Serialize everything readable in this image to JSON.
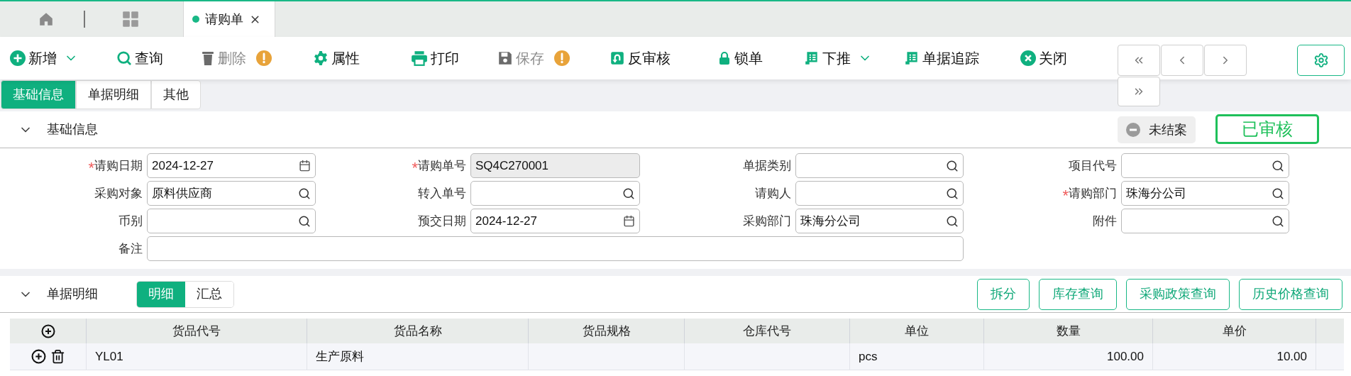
{
  "tabs": [
    {
      "label": "请购单",
      "selected": true
    }
  ],
  "toolbar": [
    {
      "label": "新增",
      "disabled": false,
      "warning": false,
      "dropdown": true
    },
    {
      "label": "查询",
      "disabled": false,
      "warning": false,
      "dropdown": false
    },
    {
      "label": "删除",
      "disabled": true,
      "warning": true,
      "dropdown": false
    },
    {
      "label": "属性",
      "disabled": false,
      "warning": false,
      "dropdown": false
    },
    {
      "label": "打印",
      "disabled": false,
      "warning": false,
      "dropdown": false
    },
    {
      "label": "保存",
      "disabled": true,
      "warning": true,
      "dropdown": false
    },
    {
      "label": "反审核",
      "disabled": false,
      "warning": false,
      "dropdown": false
    },
    {
      "label": "锁单",
      "disabled": false,
      "warning": false,
      "dropdown": false
    },
    {
      "label": "下推",
      "disabled": false,
      "warning": false,
      "dropdown": true
    },
    {
      "label": "单据追踪",
      "disabled": false,
      "warning": false,
      "dropdown": false
    },
    {
      "label": "关闭",
      "disabled": false,
      "warning": false,
      "dropdown": false
    }
  ],
  "page_tabs": [
    {
      "label": "基础信息",
      "selected": true
    },
    {
      "label": "单据明细",
      "selected": false
    },
    {
      "label": "其他",
      "selected": false
    }
  ],
  "basic_section": {
    "title": "基础信息",
    "expanded": true,
    "required_mark": "*",
    "status_badge": "未结案",
    "stamp": "已审核",
    "fields": [
      {
        "label": "请购日期",
        "required": true,
        "kind": "date",
        "value": "2024-12-27"
      },
      {
        "label": "请购单号",
        "required": true,
        "kind": "readonly",
        "value": "SQ4C270001"
      },
      {
        "label": "单据类别",
        "required": false,
        "kind": "lookup"
      },
      {
        "label": "项目代号",
        "required": false,
        "kind": "lookup"
      },
      {
        "label": "采购对象",
        "required": false,
        "kind": "lookup",
        "value": "原料供应商"
      },
      {
        "label": "转入单号",
        "required": false,
        "kind": "lookup"
      },
      {
        "label": "请购人",
        "required": false,
        "kind": "lookup"
      },
      {
        "label": "请购部门",
        "required": true,
        "kind": "lookup",
        "value": "珠海分公司"
      },
      {
        "label": "币别",
        "required": false,
        "kind": "lookup"
      },
      {
        "label": "预交日期",
        "required": false,
        "kind": "date",
        "value": "2024-12-27"
      },
      {
        "label": "采购部门",
        "required": false,
        "kind": "lookup",
        "value": "珠海分公司"
      },
      {
        "label": "附件",
        "required": false,
        "kind": "lookup"
      },
      {
        "label": "备注",
        "required": false,
        "kind": "wide"
      }
    ]
  },
  "detail_section": {
    "title": "单据明细",
    "expanded": true,
    "view_toggle": [
      {
        "label": "明细",
        "selected": true
      },
      {
        "label": "汇总",
        "selected": false
      }
    ],
    "buttons": [
      "拆分",
      "库存查询",
      "采购政策查询",
      "历史价格查询"
    ],
    "table": {
      "columns": [
        {
          "label": "货品代号",
          "kind": "text"
        },
        {
          "label": "货品名称",
          "kind": "text"
        },
        {
          "label": "货品规格",
          "kind": "text"
        },
        {
          "label": "仓库代号",
          "kind": "text"
        },
        {
          "label": "单位",
          "kind": "text"
        },
        {
          "label": "数量",
          "kind": "number"
        },
        {
          "label": "单价",
          "kind": "number"
        }
      ],
      "rows": [
        [
          "YL01",
          "生产原料",
          "",
          "",
          "pcs",
          "100.00",
          "10.00"
        ]
      ]
    }
  }
}
